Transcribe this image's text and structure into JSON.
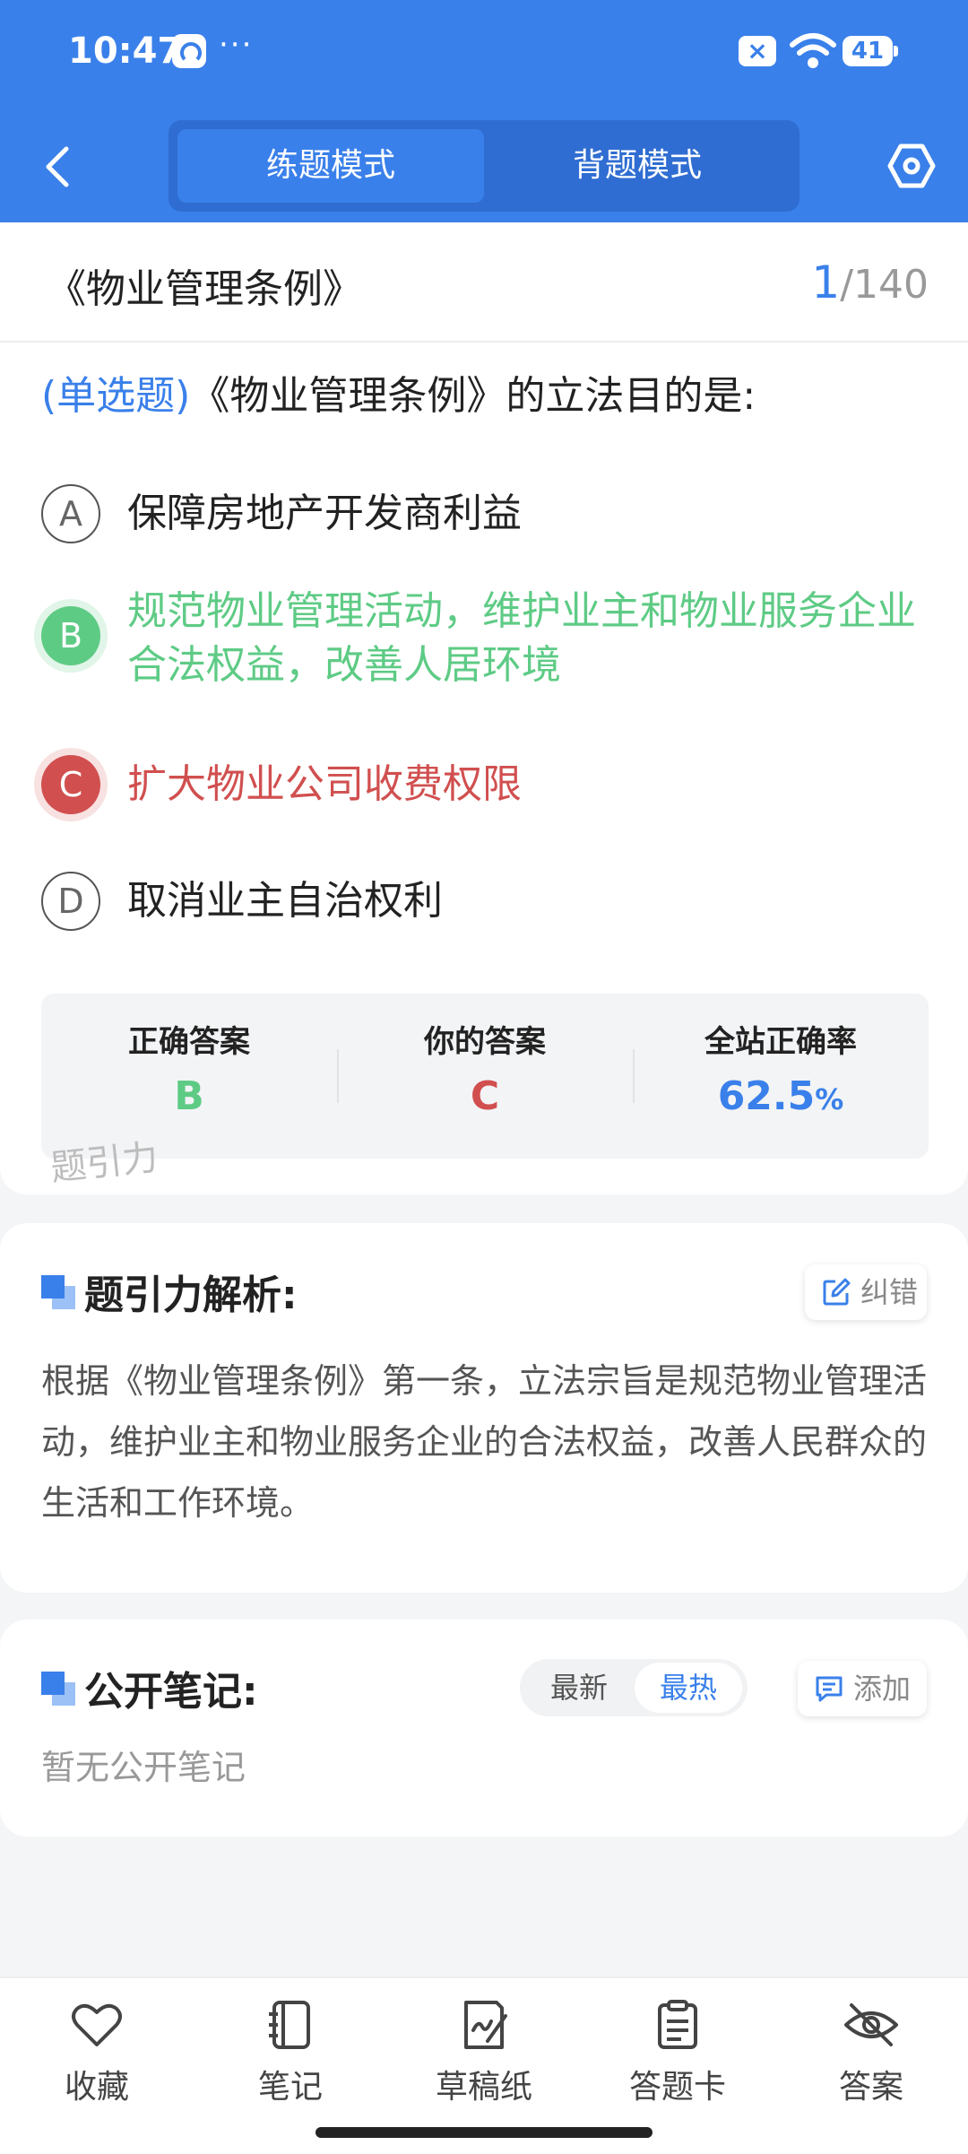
{
  "status_bar": {
    "time": "10:47",
    "dots": "···",
    "battery": "41"
  },
  "header": {
    "tabs": [
      {
        "label": "练题模式",
        "active": true
      },
      {
        "label": "背题模式",
        "active": false
      }
    ]
  },
  "title_bar": {
    "title": "《物业管理条例》",
    "current": "1",
    "total": "/140"
  },
  "question": {
    "type": "(单选题)",
    "text": "《物业管理条例》的立法目的是:",
    "options": [
      {
        "letter": "A",
        "text": "保障房地产开发商利益",
        "state": "normal"
      },
      {
        "letter": "B",
        "text": "规范物业管理活动，维护业主和物业服务企业合法权益，改善人居环境",
        "state": "correct"
      },
      {
        "letter": "C",
        "text": "扩大物业公司收费权限",
        "state": "wrong"
      },
      {
        "letter": "D",
        "text": "取消业主自治权利",
        "state": "normal"
      }
    ]
  },
  "stats": {
    "correct_label": "正确答案",
    "correct_value": "B",
    "yours_label": "你的答案",
    "yours_value": "C",
    "rate_label": "全站正确率",
    "rate_value": "62.5",
    "rate_unit": "%"
  },
  "watermark": "题引力",
  "analysis": {
    "title": "题引力解析:",
    "report_label": "纠错",
    "text": "根据《物业管理条例》第一条，立法宗旨是规范物业管理活动，维护业主和物业服务企业的合法权益，改善人民群众的生活和工作环境。"
  },
  "notes": {
    "title": "公开笔记:",
    "sort_options": [
      "最新",
      "最热"
    ],
    "active_sort": "最热",
    "add_label": "添加",
    "empty_text": "暂无公开笔记"
  },
  "bottom_nav": [
    {
      "label": "收藏",
      "icon": "heart-icon"
    },
    {
      "label": "笔记",
      "icon": "notebook-icon"
    },
    {
      "label": "草稿纸",
      "icon": "draft-icon"
    },
    {
      "label": "答题卡",
      "icon": "answer-card-icon"
    },
    {
      "label": "答案",
      "icon": "eye-off-icon"
    }
  ],
  "colors": {
    "primary": "#3a80ea",
    "correct": "#5ecb85",
    "wrong": "#d14f4f"
  }
}
